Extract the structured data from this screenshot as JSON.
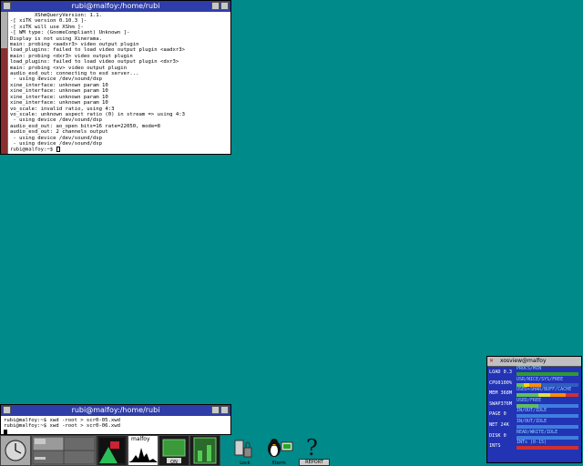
{
  "terminal1": {
    "title": "rubi@malfoy:/home/rubi",
    "lines": [
      "        XShmQueryVersion: 1.1.",
      "-[ xiTK version 0.10.3 ]-",
      "-[ xiTK will use XShm ]-",
      "-[ WM type: (GnomeCompliant) Unknown ]-",
      "Display is not using Xinerama.",
      "main: probing <aadxr3> video output plugin",
      "load_plugins: failed to load video output plugin <aadxr3>",
      "main: probing <dxr3> video output plugin",
      "load_plugins: failed to load video output plugin <dxr3>",
      "main: probing <xv> video output plugin",
      "audio_esd_out: connecting to esd server...",
      " - using device /dev/sound/dsp",
      "xine_interface: unknown param 10",
      "xine_interface: unknown param 10",
      "xine_interface: unknown param 10",
      "xine_interface: unknown param 10",
      "vo_scale: invalid ratio, using 4:3",
      "vo_scale: unknown aspect ratio (0) in stream => using 4:3",
      " - using device /dev/sound/dsp",
      "audio_esd_out: ao_open bits=16 rate=22050, mode=8",
      "audio_esd_out: 2 channels output",
      " - using device /dev/sound/dsp",
      " - using device /dev/sound/dsp"
    ],
    "prompt": "rubi@malfoy:~$ "
  },
  "terminal2": {
    "title": "rubi@malfoy:/home/rubi",
    "lines": [
      "rubi@malfoy:~$ xwd -root > scr0-05.xwd",
      "rubi@malfoy:~$ xwd -root > scr0-06.xwd"
    ]
  },
  "dock": {
    "host_label": "malfoy",
    "lock_label": "Lock",
    "xterm_label": "Xterm",
    "help_label": "REPORT",
    "mixer_label": "ON"
  },
  "xosview": {
    "title": "xosview@malfoy",
    "rows": [
      {
        "label": "LOAD 0.3",
        "legend": "PROCS/MIN"
      },
      {
        "label": "CPU0100%",
        "legend": "USR/NICE/SYS/FREE"
      },
      {
        "label": "MEM 368M",
        "legend": "USED+SHAR/BUFF/CACHE"
      },
      {
        "label": "SWAP376M",
        "legend": "USED/FREE"
      },
      {
        "label": "PAGE 0",
        "legend": "IN/OUT/IDLE"
      },
      {
        "label": "NET 24K",
        "legend": "IN/OUT/IDLE"
      },
      {
        "label": "DISK 0",
        "legend": "READ/WRITE/IDLE"
      },
      {
        "label": "INTS",
        "legend": "INTs (0-15)"
      }
    ]
  },
  "colors": {
    "desktop": "#008a8a",
    "titlebar": "#2f3da8",
    "xosview_bg": "#2233b4"
  }
}
